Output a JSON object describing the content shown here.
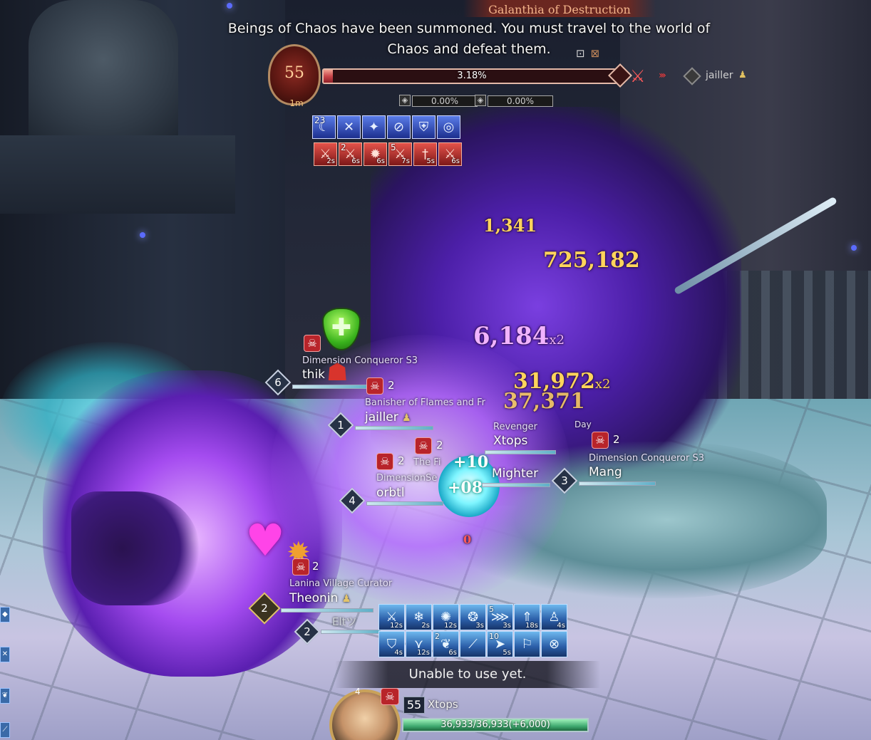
{
  "boss": {
    "title": "Galanthia of Destruction",
    "level": "55",
    "timer": "1m",
    "hp_percent_text": "3.18%",
    "hp_fraction": 0.0318,
    "sub_bar_1": "0.00%",
    "sub_bar_2": "0.00%",
    "target_name": "jailler"
  },
  "notice": "Beings of Chaos have been summoned. You must travel to the world of Chaos and defeat them.",
  "boss_buffs": [
    {
      "icon": "moon-slash-icon",
      "glyph": "☾",
      "count": "23",
      "color": "blue"
    },
    {
      "icon": "crossed-blades-icon",
      "glyph": "✕",
      "color": "blue"
    },
    {
      "icon": "muscle-icon",
      "glyph": "✦",
      "color": "blue"
    },
    {
      "icon": "broken-chain-icon",
      "glyph": "⊘",
      "color": "blue"
    },
    {
      "icon": "shield-cross-icon",
      "glyph": "⛨",
      "color": "blue"
    },
    {
      "icon": "target-icon",
      "glyph": "◎",
      "color": "blue"
    }
  ],
  "boss_debuffs": [
    {
      "icon": "sword-fire-icon",
      "glyph": "⚔",
      "time": "2s"
    },
    {
      "icon": "sword-fire-icon",
      "glyph": "⚔",
      "count": "2",
      "time": "6s"
    },
    {
      "icon": "flame-burst-icon",
      "glyph": "✹",
      "time": "6s"
    },
    {
      "icon": "sword-fire-icon",
      "glyph": "⚔",
      "count": "5",
      "time": "7s"
    },
    {
      "icon": "dagger-icon",
      "glyph": "†",
      "time": "5s"
    },
    {
      "icon": "sword-fire-icon",
      "glyph": "⚔",
      "time": "6s"
    }
  ],
  "damage_numbers": [
    {
      "value": "1,341",
      "color": "gold",
      "size": 24
    },
    {
      "value": "725,182",
      "color": "gold",
      "size": 30
    },
    {
      "value": "6,184",
      "mult": "x2",
      "color": "pink",
      "size": 34
    },
    {
      "value": "31,972",
      "mult": "x2",
      "color": "gold",
      "size": 30
    },
    {
      "value": "37,371",
      "color": "gold",
      "size": 30
    },
    {
      "value": "0",
      "color": "gold",
      "size": 16
    }
  ],
  "heals": [
    {
      "value": "+10"
    },
    {
      "value": "+08"
    }
  ],
  "party": [
    {
      "level": "6",
      "title": "Dimension Conqueror S3",
      "name": "thik",
      "skulls": ""
    },
    {
      "level": "1",
      "title": "Banisher of Flames and Fr",
      "name": "jailler",
      "skulls": "2"
    },
    {
      "level": "",
      "title": "Revenger",
      "name": "Xtops",
      "skulls": ""
    },
    {
      "level": "3",
      "title": "Dimension Conqueror S3",
      "name": "Mang",
      "skulls": "2",
      "extra": "Day"
    },
    {
      "level": "4",
      "title": "DimensionSe",
      "name": "orbtl",
      "skulls": "2"
    },
    {
      "level": "",
      "title": "The Fi",
      "name": "Mighter",
      "skulls": "2"
    },
    {
      "level": "2",
      "title": "Lanina Village Curator",
      "name": "Theonin",
      "skulls": "2"
    },
    {
      "level": "2",
      "title": "",
      "name": "Eltツ",
      "skulls": ""
    }
  ],
  "skills": [
    {
      "icon": "sword-up-icon",
      "glyph": "⚔",
      "cd": "12s"
    },
    {
      "icon": "ice-spike-icon",
      "glyph": "❄",
      "cd": "2s"
    },
    {
      "icon": "starburst-icon",
      "glyph": "✺",
      "cd": "12s"
    },
    {
      "icon": "whirl-icon",
      "glyph": "❂",
      "cd": "3s"
    },
    {
      "icon": "claw-icon",
      "glyph": "⋙",
      "count": "5",
      "cd": "3s"
    },
    {
      "icon": "rising-arrow-icon",
      "glyph": "⇑",
      "cd": "18s"
    },
    {
      "icon": "figure-icon",
      "glyph": "♙",
      "cd": "4s"
    },
    {
      "icon": "guard-icon",
      "glyph": "⛉",
      "cd": "4s"
    },
    {
      "icon": "wing-icon",
      "glyph": "⋎",
      "cd": "12s"
    },
    {
      "icon": "feather-icon",
      "glyph": "❦",
      "count": "2",
      "cd": "6s"
    },
    {
      "icon": "slash-icon",
      "glyph": "⟋",
      "cd": ""
    },
    {
      "icon": "dash-icon",
      "glyph": "➤",
      "count": "10",
      "cd": "5s"
    },
    {
      "icon": "runner-icon",
      "glyph": "⚐",
      "cd": ""
    },
    {
      "icon": "cross-circle-icon",
      "glyph": "⊗",
      "cd": ""
    }
  ],
  "status_message": "Unable to use yet.",
  "player": {
    "name": "Xtops",
    "level": "55",
    "badge_num": "4",
    "hp_text": "36,933/36,933(+6,000)",
    "hp_fraction": 1.0
  },
  "colors": {
    "boss_hp": "#c9464a",
    "player_hp": "#3faa70",
    "skill_blue": "#2b5ea8",
    "damage_gold": "#ffd45c",
    "damage_pink": "#f1b3ff"
  }
}
